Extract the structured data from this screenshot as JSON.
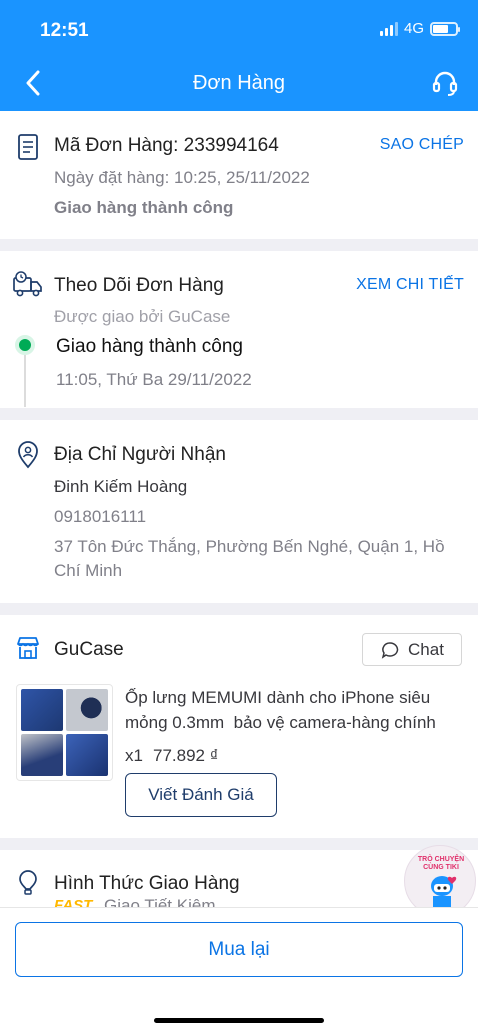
{
  "status_bar": {
    "time": "12:51",
    "network": "4G"
  },
  "header": {
    "title": "Đơn Hàng"
  },
  "order": {
    "code_label": "Mã Đơn Hàng: 233994164",
    "copy_label": "SAO CHÉP",
    "date": "Ngày đặt hàng: 10:25, 25/11/2022",
    "status": "Giao hàng thành công"
  },
  "tracking": {
    "title": "Theo Dõi Đơn Hàng",
    "detail_label": "XEM CHI TIẾT",
    "carrier": "Được giao bởi GuCase",
    "status": "Giao hàng thành công",
    "time": "11:05, Thứ Ba 29/11/2022"
  },
  "address": {
    "title": "Địa Chỉ Người Nhận",
    "name": "Đinh Kiếm Hoàng",
    "phone": "0918016111",
    "line1": "37 Tôn Đức Thắng, Phường Bến Nghé, Quận 1, Hồ",
    "line2": "Chí Minh"
  },
  "shop": {
    "name": "GuCase",
    "chat_label": "Chat",
    "product": {
      "title_line1": "Ốp lưng MEMUMI dành cho iPhone siêu",
      "title_line2": "mỏng 0.3mm  bảo vệ camera-hàng chính",
      "qty": "x1",
      "price": "77.892 ₫"
    },
    "review_label": "Viết Đánh Giá"
  },
  "shipping": {
    "title": "Hình Thức Giao Hàng",
    "badge": "FAST",
    "method": "Giao Tiết Kiệm"
  },
  "chat_bubble": {
    "line1": "TRÒ CHUYỆN",
    "line2": "CÙNG TIKI"
  },
  "actions": {
    "rebuy_label": "Mua lại"
  },
  "colors": {
    "primary": "#1a94ff",
    "link": "#0b74e5",
    "success": "#00ab56",
    "fast": "#ffb800"
  }
}
